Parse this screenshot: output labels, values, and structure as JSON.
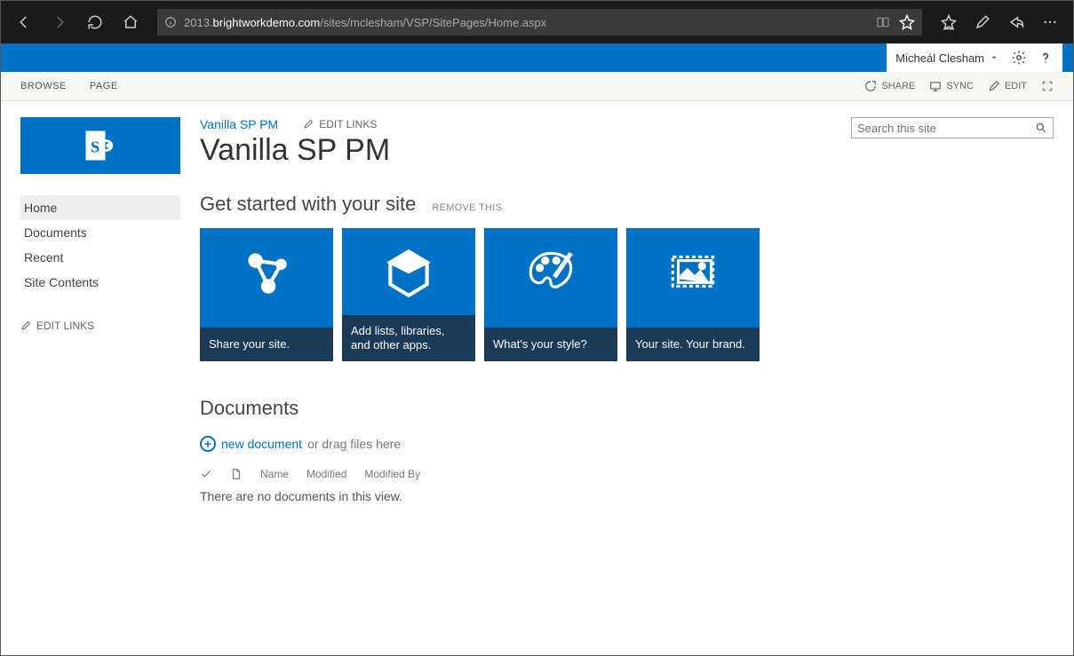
{
  "browser": {
    "url_prefix": "2013.",
    "url_host": "brightworkdemo.com",
    "url_path": "/sites/mclesham/VSP/SitePages/Home.aspx"
  },
  "suite": {
    "user": "Micheál Clesham"
  },
  "ribbon": {
    "tabs": [
      "BROWSE",
      "PAGE"
    ],
    "actions": {
      "share": "SHARE",
      "sync": "SYNC",
      "edit": "EDIT"
    }
  },
  "sidebar": {
    "items": [
      "Home",
      "Documents",
      "Recent",
      "Site Contents"
    ],
    "edit_links": "EDIT LINKS"
  },
  "breadcrumb": {
    "site": "Vanilla SP PM",
    "edit_links": "EDIT LINKS"
  },
  "page_title": "Vanilla SP PM",
  "search": {
    "placeholder": "Search this site"
  },
  "getstarted": {
    "heading": "Get started with your site",
    "remove": "REMOVE THIS",
    "tiles": [
      "Share your site.",
      "Add lists, libraries, and other apps.",
      "What's your style?",
      "Your site. Your brand."
    ]
  },
  "documents": {
    "heading": "Documents",
    "new_link": "new document",
    "new_hint": "or drag files here",
    "columns": [
      "Name",
      "Modified",
      "Modified By"
    ],
    "empty": "There are no documents in this view."
  }
}
